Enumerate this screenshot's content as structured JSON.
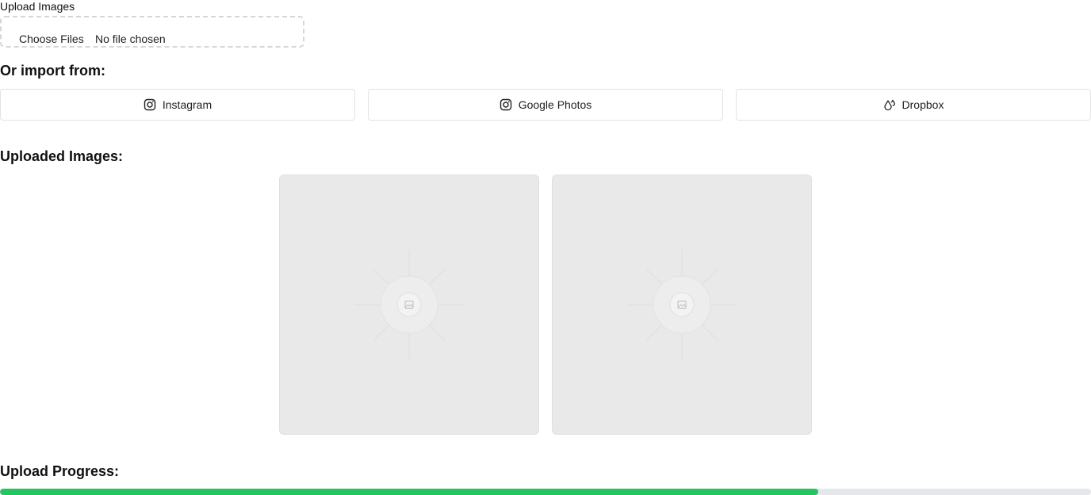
{
  "upload": {
    "label": "Upload Images",
    "choose_label": "Choose Files",
    "file_status": "No file chosen"
  },
  "import": {
    "heading": "Or import from:",
    "sources": [
      {
        "label": "Instagram",
        "icon": "instagram-icon"
      },
      {
        "label": "Google Photos",
        "icon": "instagram-icon"
      },
      {
        "label": "Dropbox",
        "icon": "dropbox-icon"
      }
    ]
  },
  "uploaded": {
    "heading": "Uploaded Images:",
    "images": [
      {
        "icon": "image-placeholder-icon"
      },
      {
        "icon": "image-placeholder-icon"
      }
    ]
  },
  "progress": {
    "heading": "Upload Progress:",
    "value": 75,
    "fill_color": "#22c55e",
    "track_color": "#e5e7eb"
  }
}
